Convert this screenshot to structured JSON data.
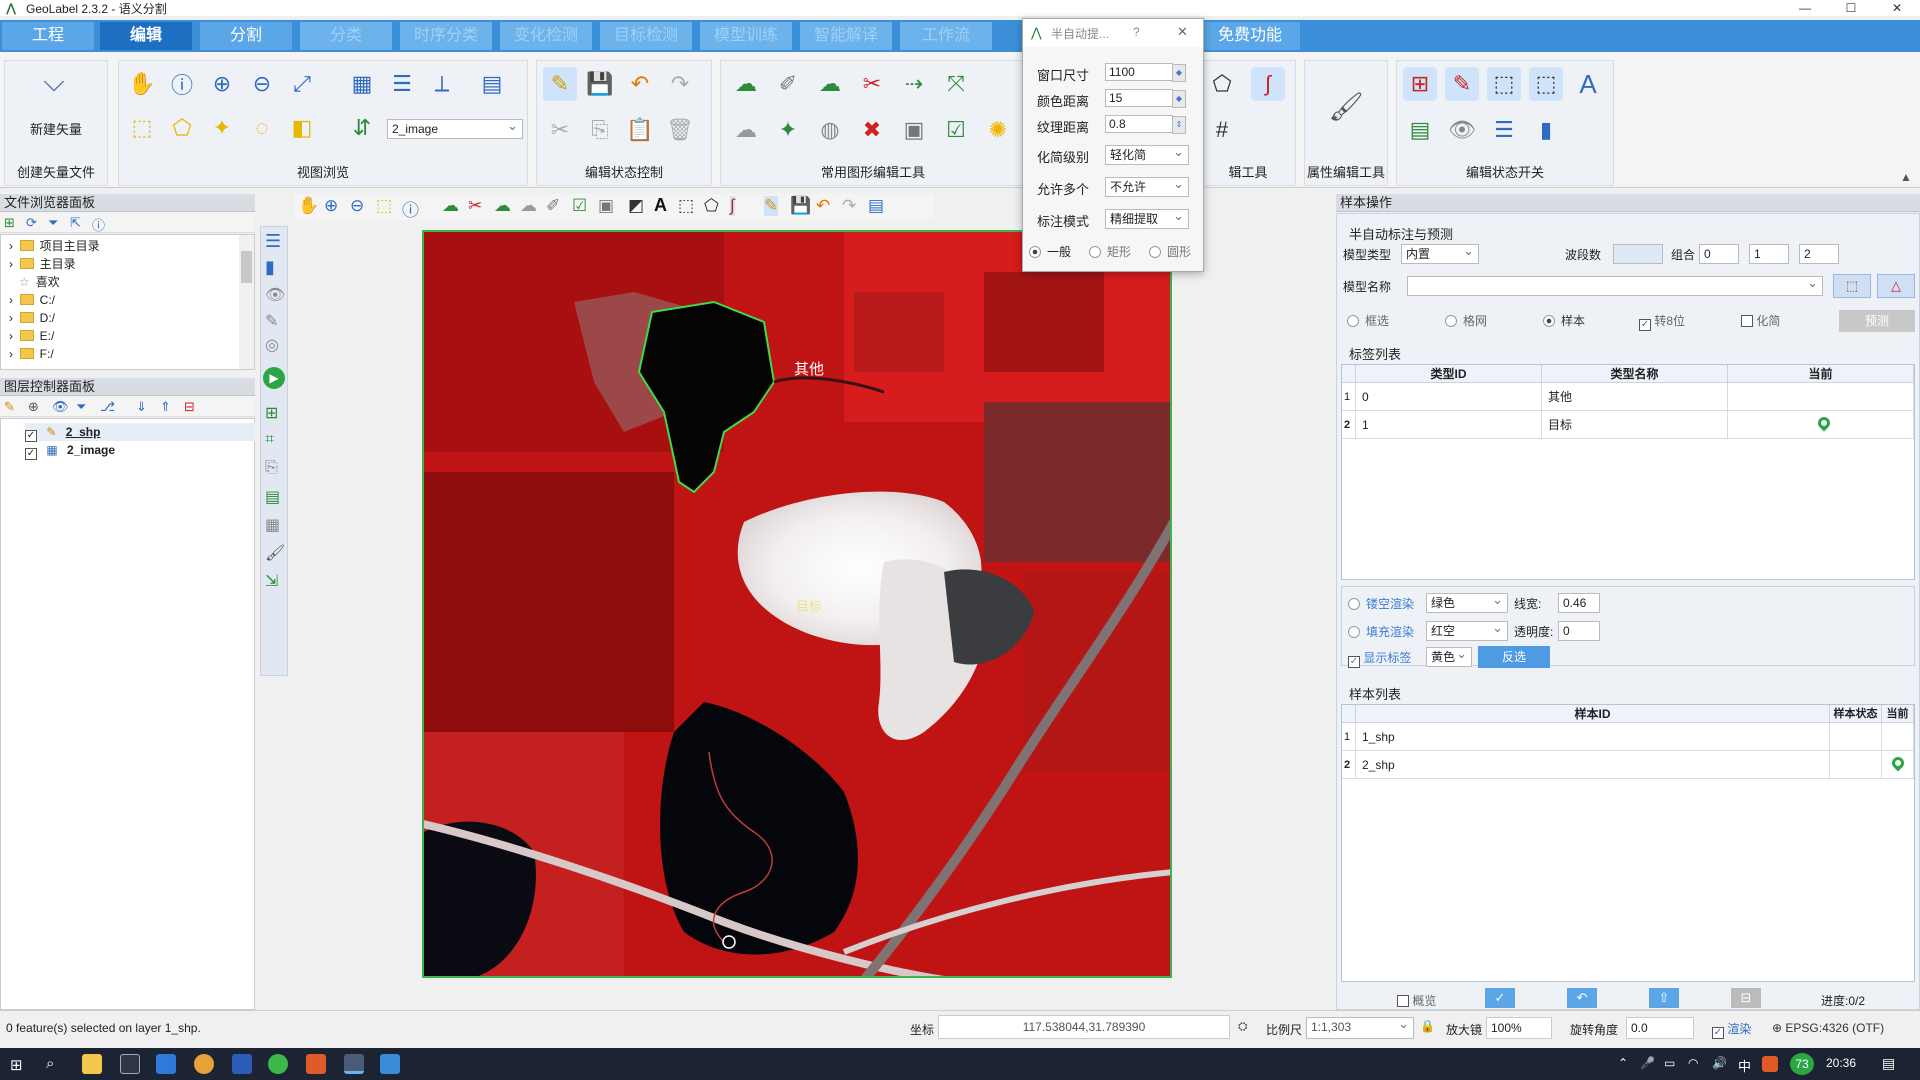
{
  "window": {
    "title": "GeoLabel 2.3.2 - 语义分割",
    "min": "—",
    "max": "☐",
    "close": "✕"
  },
  "menu": {
    "tabs": [
      "工程",
      "编辑",
      "分割",
      "分类",
      "时序分类",
      "变化检测",
      "目标检测",
      "模型训练",
      "智能解译",
      "工作流",
      "免费功能"
    ],
    "active": 1
  },
  "ribbon": {
    "groups": [
      "创建矢量文件",
      "视图浏览",
      "编辑状态控制",
      "常用图形编辑工具",
      "辑工具",
      "属性编辑工具",
      "编辑状态开关"
    ],
    "new_vector_label": "新建矢量",
    "layer_select": "2_image"
  },
  "dialog": {
    "title": "半自动提...",
    "help": "?",
    "close": "✕",
    "rows": [
      {
        "label": "窗口尺寸",
        "value": "1100"
      },
      {
        "label": "颜色距离",
        "value": "15"
      },
      {
        "label": "纹理距离",
        "value": "0.8"
      },
      {
        "label": "化简级别",
        "value": "轻化简"
      },
      {
        "label": "允许多个",
        "value": "不允许"
      },
      {
        "label": "标注模式",
        "value": "精细提取"
      }
    ],
    "shape_modes": [
      "一般",
      "矩形",
      "圆形"
    ]
  },
  "file_browser": {
    "title": "文件浏览器面板",
    "items": [
      "项目主目录",
      "主目录",
      "喜欢",
      "C:/",
      "D:/",
      "E:/",
      "F:/"
    ]
  },
  "layer_panel": {
    "title": "图层控制器面板",
    "layers": [
      {
        "name": "2_shp",
        "checked": true
      },
      {
        "name": "2_image",
        "checked": true
      }
    ]
  },
  "map": {
    "label_other": "其他",
    "label_target": "目标"
  },
  "sample_ops": {
    "title": "样本操作",
    "semi_title": "半自动标注与预测",
    "model_type_label": "模型类型",
    "model_type": "内置",
    "bands_label": "波段数",
    "combo_label": "组合",
    "combo_values": [
      "0",
      "1",
      "2"
    ],
    "model_name_label": "模型名称",
    "options": [
      "框选",
      "格网",
      "样本",
      "转8位",
      "化简"
    ],
    "predict_btn": "预测",
    "label_list_title": "标签列表",
    "label_cols": [
      "类型ID",
      "类型名称",
      "当前"
    ],
    "labels": [
      {
        "row": "1",
        "id": "0",
        "name": "其他"
      },
      {
        "row": "2",
        "id": "1",
        "name": "目标"
      }
    ],
    "render": {
      "hollow_label": "镂空渲染",
      "hollow_color": "绿色",
      "linewidth_label": "线宽:",
      "linewidth": "0.46",
      "fill_label": "填充渲染",
      "fill_color": "红空",
      "opacity_label": "透明度:",
      "opacity": "0",
      "show_label": "显示标签",
      "label_color": "黄色",
      "invert_btn": "反选"
    },
    "sample_list_title": "样本列表",
    "sample_cols": [
      "样本ID",
      "样本状态",
      "当前"
    ],
    "samples": [
      {
        "row": "1",
        "id": "1_shp"
      },
      {
        "row": "2",
        "id": "2_shp"
      }
    ],
    "overview_label": "概览",
    "progress": "进度:0/2"
  },
  "status": {
    "selection": "0 feature(s) selected on layer 1_shp.",
    "coord_label": "坐标",
    "coord": "117.538044,31.789390",
    "scale_label": "比例尺",
    "scale": "1:1,303",
    "zoom_label": "放大镜",
    "zoom": "100%",
    "rotate_label": "旋转角度",
    "rotate": "0.0",
    "render_label": "渲染",
    "epsg": "EPSG:4326 (OTF)"
  },
  "taskbar": {
    "time": "20:36",
    "ime": "中",
    "badge": "73"
  },
  "colors": {
    "menu": "#3b8fd8",
    "active_tab": "#1d6fc2",
    "outline": "#3cb44b"
  }
}
